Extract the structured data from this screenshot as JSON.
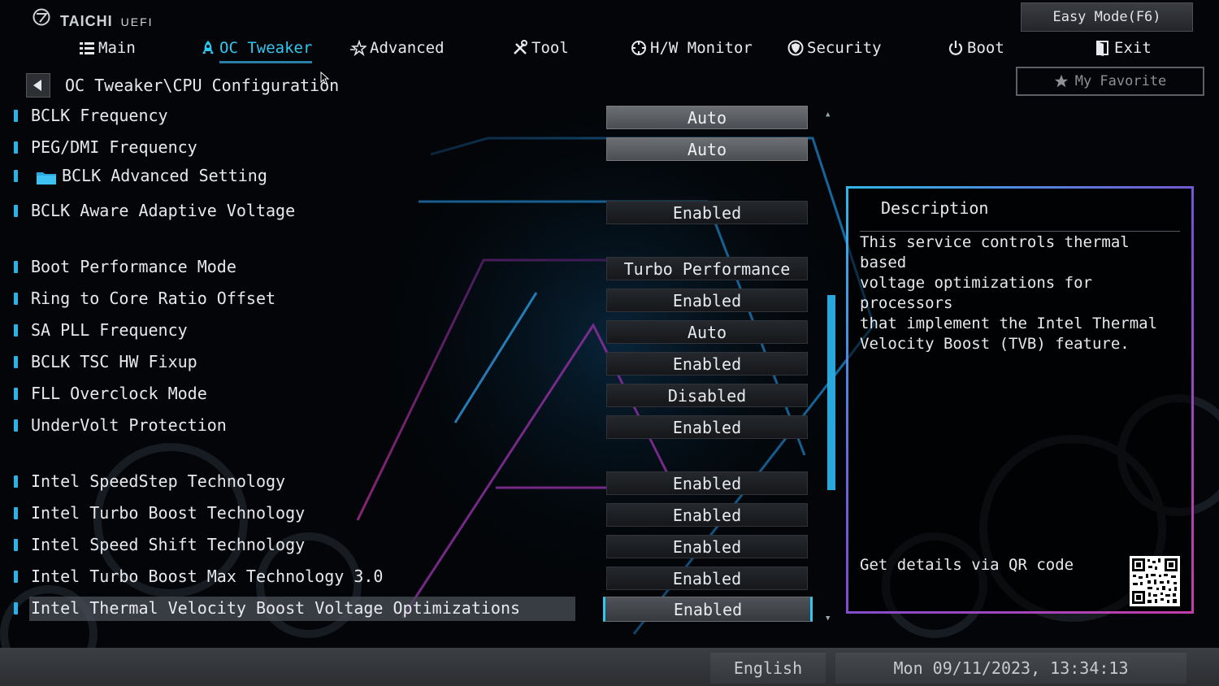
{
  "app": {
    "brand": "TAICHI",
    "sub": "UEFI"
  },
  "easy_mode_label": "Easy Mode(F6)",
  "nav": {
    "tabs": [
      {
        "label": "Main",
        "icon": "list-icon",
        "active": false
      },
      {
        "label": "OC Tweaker",
        "icon": "rocket-icon",
        "active": true
      },
      {
        "label": "Advanced",
        "icon": "star-icon",
        "active": false
      },
      {
        "label": "Tool",
        "icon": "tools-icon",
        "active": false
      },
      {
        "label": "H/W Monitor",
        "icon": "monitor-icon",
        "active": false
      },
      {
        "label": "Security",
        "icon": "shield-icon",
        "active": false
      },
      {
        "label": "Boot",
        "icon": "power-icon",
        "active": false
      },
      {
        "label": "Exit",
        "icon": "door-icon",
        "active": false
      }
    ]
  },
  "breadcrumb": "OC Tweaker\\CPU Configuration",
  "favorite_label": "My Favorite",
  "settings": [
    {
      "label": "BCLK Frequency",
      "value": "Auto"
    },
    {
      "label": "PEG/DMI Frequency",
      "value": "Auto"
    },
    {
      "label": "BCLK Advanced Setting",
      "value": ""
    },
    {
      "label": "BCLK Aware Adaptive Voltage",
      "value": "Enabled"
    },
    {
      "label": "Boot Performance Mode",
      "value": "Turbo Performance"
    },
    {
      "label": "Ring to Core Ratio Offset",
      "value": "Enabled"
    },
    {
      "label": "SA PLL Frequency",
      "value": "Auto"
    },
    {
      "label": "BCLK TSC HW Fixup",
      "value": "Enabled"
    },
    {
      "label": "FLL Overclock Mode",
      "value": "Disabled"
    },
    {
      "label": "UnderVolt Protection",
      "value": "Enabled"
    },
    {
      "label": "Intel SpeedStep Technology",
      "value": "Enabled"
    },
    {
      "label": "Intel Turbo Boost Technology",
      "value": "Enabled"
    },
    {
      "label": "Intel Speed Shift Technology",
      "value": "Enabled"
    },
    {
      "label": "Intel Turbo Boost Max Technology 3.0",
      "value": "Enabled"
    },
    {
      "label": "Intel Thermal Velocity Boost Voltage Optimizations",
      "value": "Enabled"
    }
  ],
  "description": {
    "title": "Description",
    "lines": [
      "This service controls thermal based",
      "voltage optimizations for processors",
      "that implement the Intel Thermal",
      "Velocity Boost (TVB) feature."
    ],
    "qr_text": "Get details via QR code"
  },
  "status": {
    "language": "English",
    "datetime": "Mon 09/11/2023, 13:34:13"
  },
  "colors": {
    "accent": "#2fc7f0",
    "value_auto": "#5a5d62",
    "scroll_thumb": "#28a8dc"
  }
}
